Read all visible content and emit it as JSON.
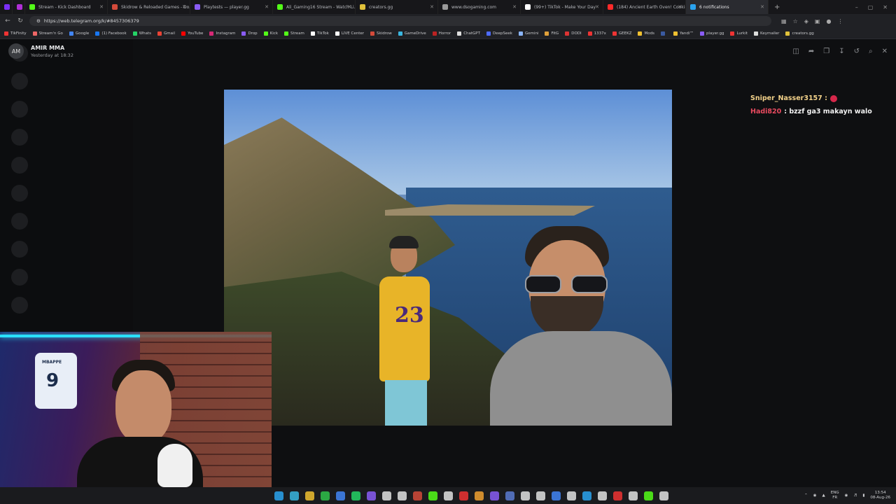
{
  "browser": {
    "tabs": [
      {
        "label": "",
        "color": "#7b2ff7"
      },
      {
        "label": "",
        "color": "#b02fd6"
      },
      {
        "label": "Stream - Kick Dashboard",
        "color": "#53fc18"
      },
      {
        "label": "Skidrow & Reloaded Games - Do...",
        "color": "#d34a3a"
      },
      {
        "label": "Playtests — player.gg",
        "color": "#8a5cf5"
      },
      {
        "label": "Ali_Gaming16 Stream - Watch Li...",
        "color": "#53fc18"
      },
      {
        "label": "creators.gg",
        "color": "#e0c13a"
      },
      {
        "label": "www.dsogaming.com",
        "color": "#9a9a9a"
      },
      {
        "label": "(99+) TikTok - Make Your Day",
        "color": "#ffffff"
      },
      {
        "label": "(184) Ancient Earth Oven! Cookin...",
        "color": "#ff2a2a"
      },
      {
        "label": "6 notifications",
        "color": "#2aa3ef"
      }
    ],
    "active_tab": 10,
    "new_tab": "+",
    "url": "https://web.telegram.org/k/#8457306379",
    "bookmarks": [
      {
        "label": "TikFinity",
        "color": "#e33"
      },
      {
        "label": "Stream'n Go",
        "color": "#e66"
      },
      {
        "label": "Google",
        "color": "#4285f4"
      },
      {
        "label": "(1) Facebook",
        "color": "#1877f2"
      },
      {
        "label": "Whats",
        "color": "#25d366"
      },
      {
        "label": "Gmail",
        "color": "#ea4335"
      },
      {
        "label": "YouTube",
        "color": "#ff0000"
      },
      {
        "label": "Instagram",
        "color": "#d62976"
      },
      {
        "label": "Drop",
        "color": "#8a5cf5"
      },
      {
        "label": "Kick",
        "color": "#53fc18"
      },
      {
        "label": "Stream",
        "color": "#53fc18"
      },
      {
        "label": "TikTok",
        "color": "#ffffff"
      },
      {
        "label": "LIVE Center",
        "color": "#ffffff"
      },
      {
        "label": "Skidrow",
        "color": "#d34a3a"
      },
      {
        "label": "GameDrive",
        "color": "#3ab6e0"
      },
      {
        "label": "Horror",
        "color": "#b22"
      },
      {
        "label": "ChatGPT",
        "color": "#ddd"
      },
      {
        "label": "DeepSeek",
        "color": "#4d6bfe"
      },
      {
        "label": "Gemini",
        "color": "#8ab4f8"
      },
      {
        "label": "FitG",
        "color": "#e0a03a"
      },
      {
        "label": "DODI",
        "color": "#d33"
      },
      {
        "label": "1337x",
        "color": "#e33"
      },
      {
        "label": "GEEKZ",
        "color": "#e33"
      },
      {
        "label": "Mods",
        "color": "#f0c030"
      },
      {
        "label": "",
        "color": "#3a5aa0"
      },
      {
        "label": "Yandi™",
        "color": "#f0c030"
      },
      {
        "label": "player.gg",
        "color": "#8a5cf5"
      },
      {
        "label": "Lurkit",
        "color": "#e33"
      },
      {
        "label": "Keymailer",
        "color": "#ddd"
      },
      {
        "label": "creators.gg",
        "color": "#e0c13a"
      }
    ]
  },
  "viewer": {
    "sender_name": "AMIR MMA",
    "sender_initials": "AM",
    "date": "Yesterday at 18:32"
  },
  "chat_overlay": [
    {
      "user": "Sniper_Nasser3157 :",
      "message": "",
      "user_color": "#f3d28a"
    },
    {
      "user": "Hadi820",
      "message": ": bzzf ga3 makayn walo",
      "user_color": "#e84a5f"
    }
  ],
  "webcam": {
    "jersey_name": "MBAPPE",
    "jersey_number": "9"
  },
  "photo": {
    "shirt_number": "23"
  },
  "taskbar": {
    "lang_top": "ENG",
    "lang_bottom": "FR",
    "time": "13:54",
    "date": "08-Aug-26",
    "icons": [
      "#2aa3ef",
      "#3ab6e0",
      "#f0c030",
      "#2fbf4a",
      "#4285f4",
      "#25d366",
      "#8a5cf5",
      "#e0e0e0",
      "#e0e0e0",
      "#d34a3a",
      "#53fc18",
      "#e0e0e0",
      "#e33",
      "#f0a030",
      "#8a5cf5",
      "#5a7ad0",
      "#e0e0e0",
      "#e0e0e0",
      "#4285f4",
      "#e0e0e0",
      "#2aa3ef",
      "#e0e0e0",
      "#e33",
      "#e0e0e0",
      "#53fc18",
      "#e0e0e0"
    ]
  }
}
